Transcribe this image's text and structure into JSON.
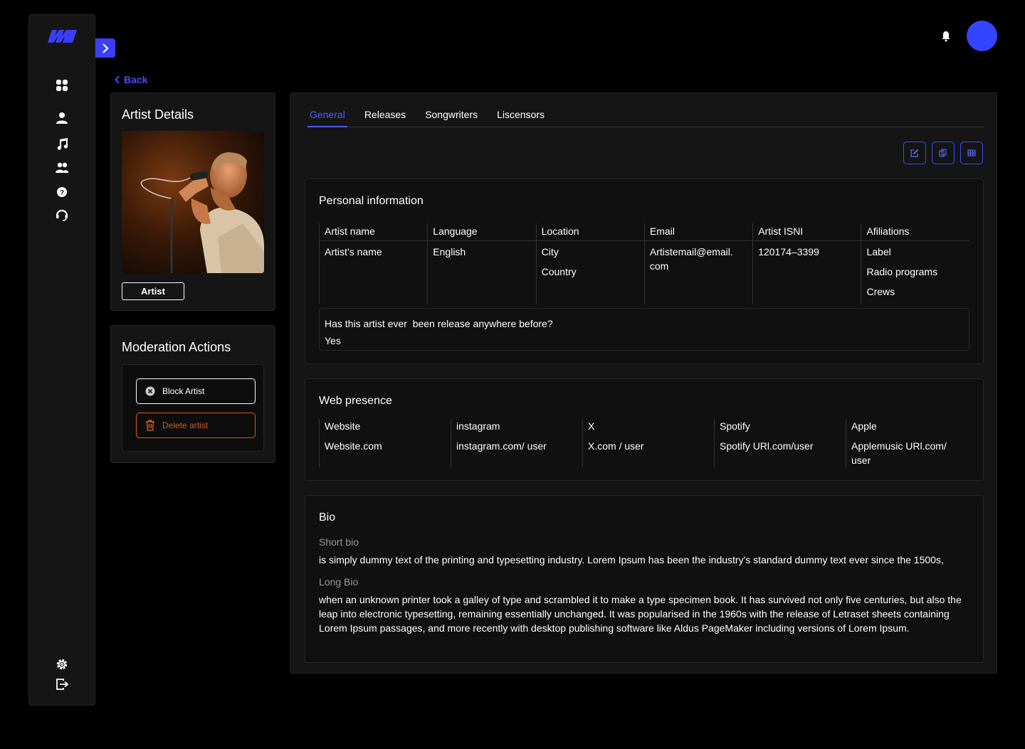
{
  "nav": {
    "items": [
      "dashboard",
      "user",
      "music",
      "team",
      "help",
      "support"
    ],
    "bottom": [
      "settings",
      "logout"
    ]
  },
  "back_label": "Back",
  "artist_card": {
    "title": "Artist Details",
    "tag": "Artist"
  },
  "moderation": {
    "title": "Moderation Actions",
    "block_label": "Block Artist",
    "delete_label": "Delete artist"
  },
  "tabs": [
    "General",
    "Releases",
    "Songwriters",
    "Liscensors"
  ],
  "personal": {
    "title": "Personal information",
    "columns": [
      {
        "head": "Artist name",
        "values": [
          "Artist’s name"
        ]
      },
      {
        "head": "Language",
        "values": [
          "English"
        ]
      },
      {
        "head": "Location",
        "values": [
          "City",
          "Country"
        ]
      },
      {
        "head": "Email",
        "values": [
          "Artistemail@email. com"
        ]
      },
      {
        "head": "Artist ISNI",
        "values": [
          "120174–3399"
        ]
      },
      {
        "head": "Afiliations",
        "values": [
          "Label",
          "Radio programs",
          "Crews"
        ]
      }
    ],
    "question": "Has this artist ever  been release anywhere before?",
    "answer": "Yes"
  },
  "web": {
    "title": "Web presence",
    "columns": [
      {
        "head": "Website",
        "value": "Website.com"
      },
      {
        "head": "instagram",
        "value": "instagram.com/ user"
      },
      {
        "head": "X",
        "value": "X.com / user"
      },
      {
        "head": "Spotify",
        "value": "Spotify URl.com/user"
      },
      {
        "head": "Apple",
        "value": "Applemusic URl.com/ user"
      }
    ]
  },
  "bio": {
    "title": "Bio",
    "short_label": "Short bio",
    "short_text": "is simply dummy text of the printing and typesetting industry. Lorem Ipsum has been the industry's standard dummy text ever since the 1500s,",
    "long_label": "Long Bio",
    "long_text": "when an unknown printer took a galley of type and scrambled it to make a type specimen book. It has survived not only five centuries, but also the leap into electronic typesetting, remaining essentially unchanged. It was popularised in the 1960s with the release of Letraset sheets containing Lorem Ipsum passages, and more recently with desktop publishing software like Aldus PageMaker including versions of Lorem Ipsum."
  },
  "colors": {
    "accent": "#3d3dff",
    "danger": "#d65a1c",
    "avatar": "#3345ff"
  }
}
